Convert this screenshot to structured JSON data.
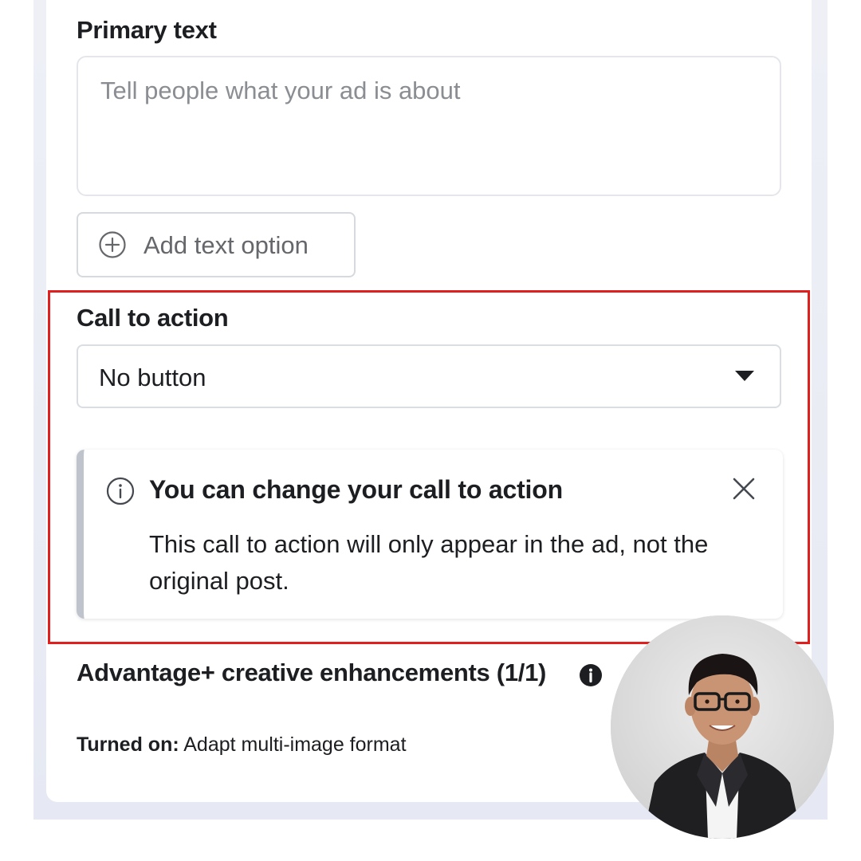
{
  "primary_text": {
    "label": "Primary text",
    "placeholder": "Tell people what your ad is about",
    "add_option_label": "Add text option"
  },
  "call_to_action": {
    "label": "Call to action",
    "selected": "No button"
  },
  "notice": {
    "title": "You can change your call to action",
    "body": "This call to action will only appear in the ad, not the original post."
  },
  "advantage": {
    "title": "Advantage+ creative enhancements (1/1)",
    "status_key": "Turned on:",
    "status_value": " Adapt multi-image format"
  },
  "icons": {
    "add_option": "plus-circle-icon",
    "dropdown": "caret-down-icon",
    "notice_info": "info-outline-icon",
    "notice_close": "close-icon",
    "advantage_info": "info-filled-icon"
  },
  "colors": {
    "highlight_border": "#e0201f",
    "text_primary": "#1c1e21",
    "text_placeholder": "#8a8d91",
    "notice_accent": "#bfc4cc"
  }
}
